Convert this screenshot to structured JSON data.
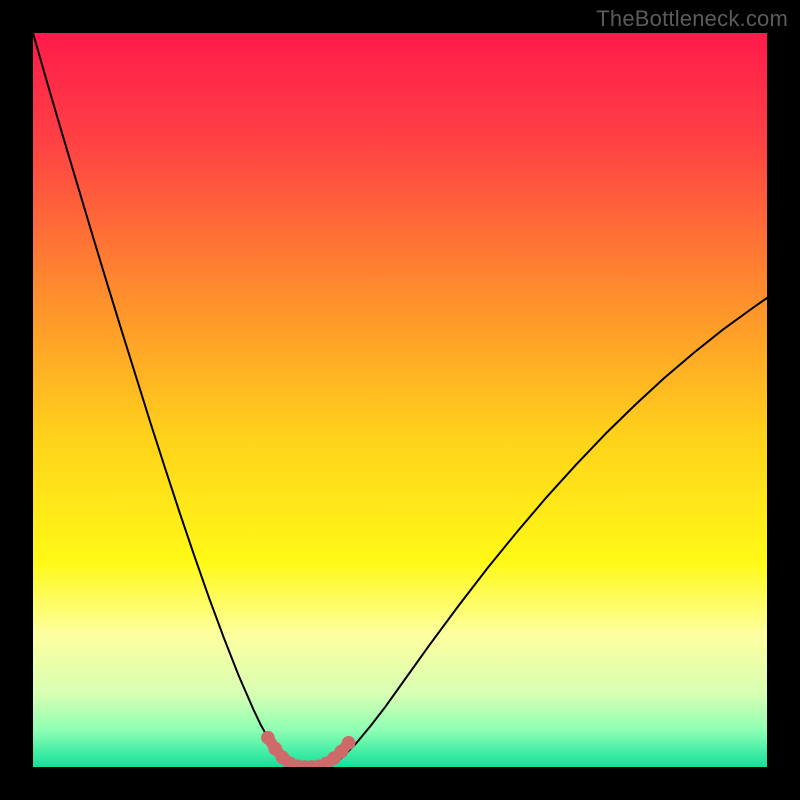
{
  "watermark": "TheBottleneck.com",
  "chart_data": {
    "type": "line",
    "title": "",
    "xlabel": "",
    "ylabel": "",
    "xlim": [
      0,
      100
    ],
    "ylim": [
      0,
      100
    ],
    "grid": false,
    "legend": false,
    "background": {
      "type": "vertical-gradient",
      "stops": [
        {
          "pos": 0.0,
          "color": "#ff1a4b"
        },
        {
          "pos": 0.15,
          "color": "#ff4244"
        },
        {
          "pos": 0.35,
          "color": "#ff8b2e"
        },
        {
          "pos": 0.55,
          "color": "#ffd21b"
        },
        {
          "pos": 0.72,
          "color": "#fff917"
        },
        {
          "pos": 0.82,
          "color": "#fdffa0"
        },
        {
          "pos": 0.9,
          "color": "#d8ffb3"
        },
        {
          "pos": 0.95,
          "color": "#8dffb3"
        },
        {
          "pos": 1.0,
          "color": "#12e09c"
        }
      ]
    },
    "series": [
      {
        "name": "curve-left",
        "color": "#000000",
        "width": 2,
        "x": [
          0.0,
          2.0,
          4.0,
          6.0,
          8.0,
          10.0,
          12.0,
          14.0,
          16.0,
          18.0,
          20.0,
          22.0,
          24.0,
          26.0,
          28.0,
          30.0,
          31.0,
          32.0,
          33.0,
          34.0,
          35.0
        ],
        "y": [
          100.0,
          93.0,
          86.2,
          79.5,
          72.8,
          66.2,
          59.7,
          53.3,
          46.9,
          40.7,
          34.6,
          28.7,
          23.0,
          17.6,
          12.5,
          7.9,
          5.8,
          4.0,
          2.5,
          1.3,
          0.5
        ]
      },
      {
        "name": "curve-right",
        "color": "#000000",
        "width": 2,
        "x": [
          41.0,
          42.0,
          44.0,
          46.0,
          48.0,
          50.0,
          54.0,
          58.0,
          62.0,
          66.0,
          70.0,
          74.0,
          78.0,
          82.0,
          86.0,
          90.0,
          94.0,
          98.0,
          100.0
        ],
        "y": [
          0.5,
          1.2,
          3.2,
          5.6,
          8.2,
          11.0,
          16.6,
          22.0,
          27.2,
          32.1,
          36.8,
          41.2,
          45.4,
          49.3,
          53.0,
          56.4,
          59.6,
          62.5,
          63.9
        ]
      },
      {
        "name": "floor-highlight",
        "color": "#cf6a6a",
        "width": 11,
        "style": "rounded-dots",
        "x": [
          32.0,
          33.0,
          34.0,
          35.0,
          36.0,
          37.0,
          38.0,
          39.0,
          40.0,
          41.0,
          42.0,
          43.0
        ],
        "y": [
          4.0,
          2.5,
          1.3,
          0.5,
          0.1,
          0.0,
          0.0,
          0.1,
          0.5,
          1.2,
          2.1,
          3.3
        ]
      }
    ]
  }
}
